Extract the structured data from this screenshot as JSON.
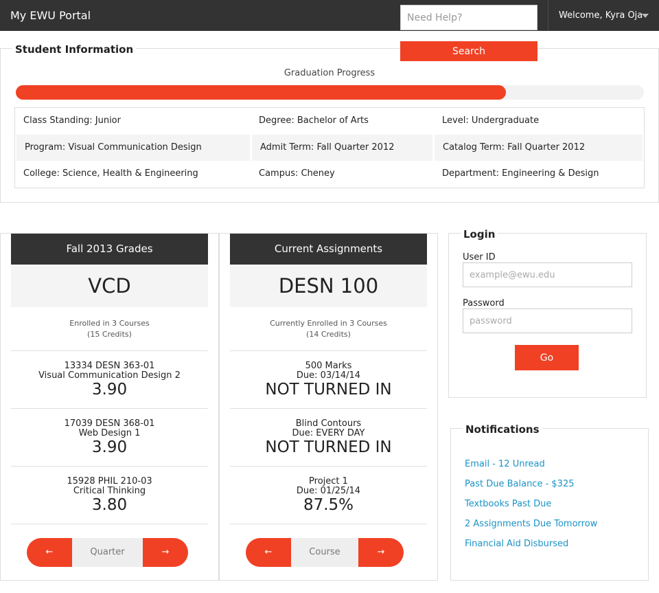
{
  "topbar": {
    "brand": "My EWU Portal",
    "help_placeholder": "Need Help?",
    "search_label": "Search",
    "welcome": "Welcome, Kyra Oja"
  },
  "student_info": {
    "title": "Student Information",
    "graduation_label": "Graduation Progress",
    "graduation_progress_pct": 78,
    "rows": [
      [
        "Class Standing: Junior",
        "Degree: Bachelor of Arts",
        "Level: Undergraduate"
      ],
      [
        "Program: Visual Communication Design",
        "Admit Term: Fall Quarter 2012",
        "Catalog Term: Fall Quarter 2012"
      ],
      [
        "College: Science, Health & Engineering",
        "Campus: Cheney",
        "Department: Engineering & Design"
      ]
    ]
  },
  "grades": {
    "header": "Fall 2013 Grades",
    "big": "VCD",
    "summary_1": "Enrolled in 3 Courses",
    "summary_2": "(15 Credits)",
    "items": [
      {
        "line1": "13334 DESN 363-01",
        "line2": "Visual Communication Design 2",
        "value": "3.90"
      },
      {
        "line1": "17039 DESN 368-01",
        "line2": "Web Design 1",
        "value": "3.90"
      },
      {
        "line1": "15928 PHIL 210-03",
        "line2": "Critical Thinking",
        "value": "3.80"
      }
    ],
    "pager": {
      "prev": "←",
      "label": "Quarter",
      "next": "→"
    }
  },
  "assignments": {
    "header": "Current Assignments",
    "big": "DESN 100",
    "summary_1": "Currently Enrolled in 3 Courses",
    "summary_2": "(14 Credits)",
    "items": [
      {
        "line1": "500 Marks",
        "line2": "Due: 03/14/14",
        "value": "NOT TURNED IN"
      },
      {
        "line1": "Blind Contours",
        "line2": "Due: EVERY DAY",
        "value": "NOT TURNED IN"
      },
      {
        "line1": "Project 1",
        "line2": "Due: 01/25/14",
        "value": "87.5%"
      }
    ],
    "pager": {
      "prev": "←",
      "label": "Course",
      "next": "→"
    }
  },
  "login": {
    "title": "Login",
    "user_label": "User ID",
    "user_placeholder": "example@ewu.edu",
    "password_label": "Password",
    "password_placeholder": "password",
    "go_label": "Go"
  },
  "notifications": {
    "title": "Notifications",
    "items": [
      "Email - 12 Unread",
      "Past Due Balance - $325",
      "Textbooks Past Due",
      "2 Assignments Due Tomorrow",
      "Financial Aid Disbursed"
    ]
  },
  "colors": {
    "accent": "#f04124",
    "dark": "#333333",
    "link": "#1a93c6"
  }
}
